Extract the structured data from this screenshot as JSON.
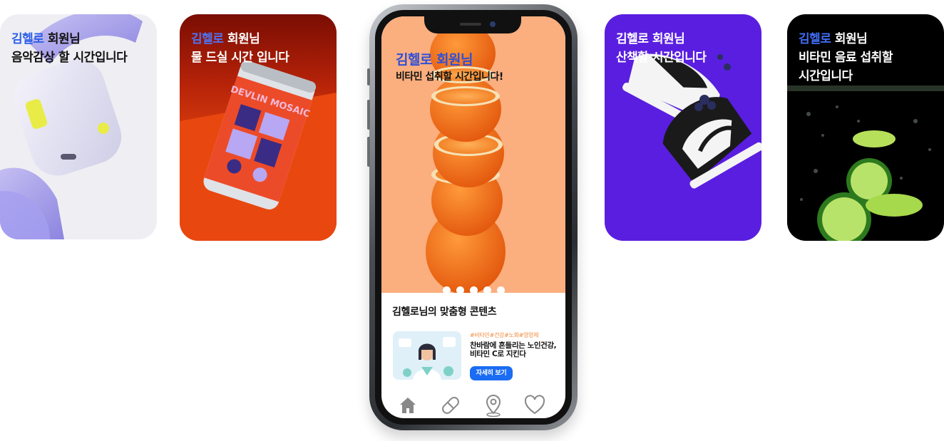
{
  "cards": [
    {
      "name": "김헬로",
      "suffix": " 회원님",
      "line2": "음악감상 할 시간입니다",
      "line3": ""
    },
    {
      "name": "김헬로",
      "suffix": " 회원님",
      "line2": "물 드실 시간 입니다",
      "line3": ""
    },
    {
      "name": "김헬로",
      "suffix": " 회원님",
      "line2": "산책할 시간입니다",
      "line3": ""
    },
    {
      "name": "김헬로",
      "suffix": " 회원님",
      "line2": "비타민 음료 섭취할",
      "line3": "시간입니다"
    }
  ],
  "phone": {
    "hero": {
      "name": "김헬로",
      "suffix": " 회원님",
      "line2": "비타민 섭취할 시간입니다!"
    },
    "carousel": {
      "count": 5,
      "active": 0
    },
    "section_title": "김헬로님의 맞춤형 콘텐츠",
    "article": {
      "tags": "#비타민#건강#노화#영양제",
      "headline_1": "찬바람에 흔들리는 노인건강,",
      "headline_2": "비타민 C로 지킨다",
      "button": "자세히 보기"
    },
    "tabs": [
      "home-icon",
      "pill-icon",
      "location-pin-icon",
      "heart-icon"
    ]
  },
  "can_label": "DEVLIN MOSAIC",
  "colors": {
    "accent_blue": "#2f5fe8",
    "button_blue": "#1a6cf2",
    "hero_orange": "#fbae7e",
    "tag_orange": "#f08a3c"
  }
}
